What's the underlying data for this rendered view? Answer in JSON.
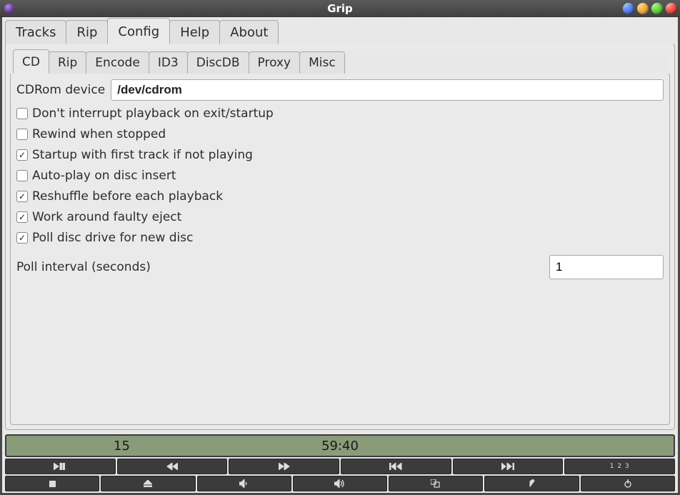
{
  "title": "Grip",
  "main_tabs": [
    "Tracks",
    "Rip",
    "Config",
    "Help",
    "About"
  ],
  "main_tab_active": 2,
  "config_tabs": [
    "CD",
    "Rip",
    "Encode",
    "ID3",
    "DiscDB",
    "Proxy",
    "Misc"
  ],
  "config_tab_active": 0,
  "cd": {
    "device_label": "CDRom device",
    "device_value": "/dev/cdrom",
    "options": [
      {
        "label": "Don't interrupt playback on exit/startup",
        "checked": false
      },
      {
        "label": "Rewind when stopped",
        "checked": false
      },
      {
        "label": "Startup with first track if not playing",
        "checked": true
      },
      {
        "label": "Auto-play on disc insert",
        "checked": false
      },
      {
        "label": "Reshuffle before each playback",
        "checked": true
      },
      {
        "label": "Work around faulty eject",
        "checked": true
      },
      {
        "label": "Poll disc drive for new disc",
        "checked": true
      }
    ],
    "poll_label": "Poll interval (seconds)",
    "poll_value": "1"
  },
  "status": {
    "track": "15",
    "time": "59:40"
  },
  "controls_row1": [
    "play-pause",
    "rewind",
    "fast-forward",
    "prev-track",
    "next-track",
    "counter-mode"
  ],
  "controls_row2": [
    "stop",
    "eject",
    "vol-down",
    "vol-up",
    "shuffle",
    "editor",
    "power"
  ]
}
